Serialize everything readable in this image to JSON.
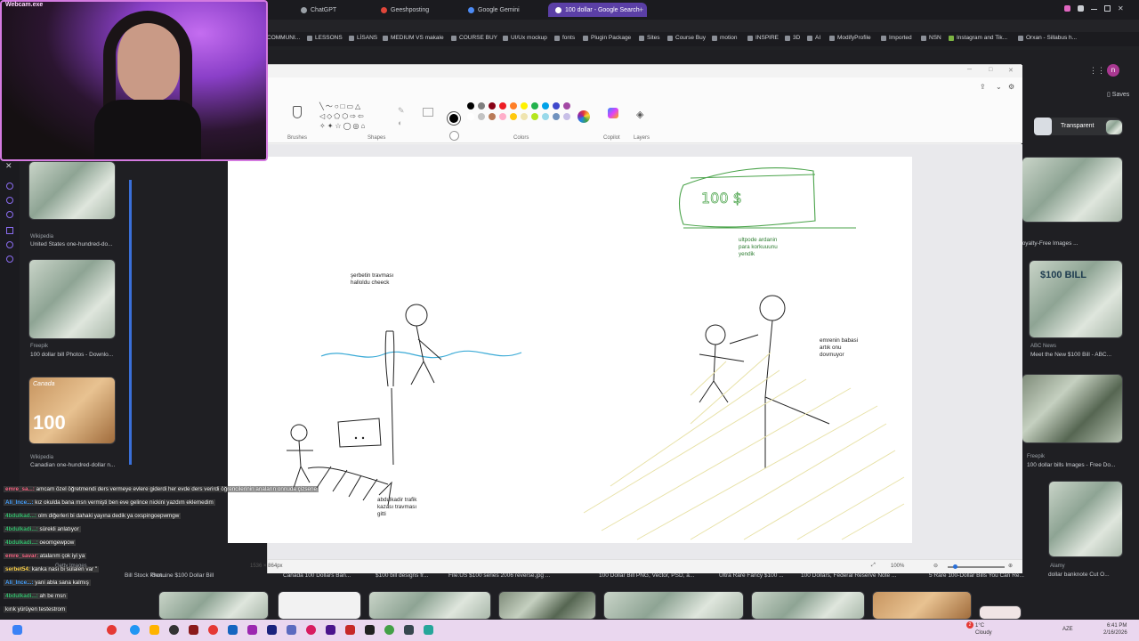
{
  "webcam": {
    "label": "Webcam.exe"
  },
  "browser": {
    "tabs": [
      {
        "label": "ChatGPT",
        "color": "#9aa0a6"
      },
      {
        "label": "Geeshposting",
        "color": "#e0463a"
      },
      {
        "label": "Google Gemini",
        "color": "#4c8bf5"
      },
      {
        "label": "100 dollar - Google Search",
        "color": "#ffffff"
      }
    ],
    "new_tab": "+",
    "bookmarks": [
      "COMMUNI...",
      "LESSONS",
      "LİSANS",
      "MEDIUM VS makale",
      "COURSE BUY",
      "UI/Ux mockup",
      "fonts",
      "Plugin Package",
      "Sites",
      "Course Buy",
      "motion",
      "INSPIRE",
      "3D",
      "AI",
      "ModifyProfile",
      "Imported",
      "NSN",
      "Instagram and Tik...",
      "Orxan - Sillabus h..."
    ],
    "profile_initial": "n",
    "saves_label": "Saves",
    "transparent_label": "Transparent"
  },
  "paint": {
    "groups": {
      "brushes": "Brushes",
      "shapes": "Shapes",
      "colors": "Colors",
      "copilot": "Copilot",
      "layers": "Layers"
    },
    "palette_row1": [
      "#000000",
      "#7f7f7f",
      "#880015",
      "#ed1c24",
      "#ff7f27",
      "#fff200",
      "#22b14c",
      "#00a2e8",
      "#3f48cc",
      "#a349a4"
    ],
    "palette_row2": [
      "#ffffff",
      "#c3c3c3",
      "#b97a57",
      "#ffaec9",
      "#ffc90e",
      "#efe4b0",
      "#b5e61d",
      "#99d9ea",
      "#7092be",
      "#c8bfe7"
    ],
    "status_size": "1536 × 864px",
    "zoom": "100%",
    "notes": {
      "serbet": "şerbetin travması\nhalloldu cheeck",
      "abdulkadir": "abdulkadir trafik\nkazası travması\ngitti",
      "ultpode": "ultpode ardanin\npara korkuuunu\nyendik",
      "emre": "emrenin babasi\nartık onu\ndovmuyor"
    },
    "sign_text": "100 $"
  },
  "results": {
    "left_items": [
      {
        "source": "Wikipedia",
        "title": "United States one-hundred-do..."
      },
      {
        "source": "Freepik",
        "title": "100 dollar bill Photos - Downlo..."
      },
      {
        "source": "Wikipedia",
        "title": "Canadian one-hundred-dollar n..."
      }
    ],
    "left_extra": "Getty Images",
    "canada_word": "Canada",
    "canada_value": "100",
    "bottom_titles": [
      "Canada 100 Dollars Ban...",
      "$100 bill designs fr...",
      "File:US $100 series 2006 reverse.jpg ...",
      "100 Dollar Bill PNG, Vector, PSD, a...",
      "Ultra Rare Fancy $100 ...",
      "100 Dollars, Federal Reserve Note ...",
      "5 Rare 100-Dollar Bills You Can Re...",
      "dollar banknote Cut O..."
    ],
    "left_bottom": [
      "Bill Stock Phot...",
      "Genuine $100 Dollar Bill"
    ],
    "right_items": [
      {
        "source": "",
        "title": "Royalty-Free Images ..."
      },
      {
        "source": "ABC News",
        "title": "Meet the New $100 Bill - ABC..."
      },
      {
        "source": "Freepik",
        "title": "100 dollar bills Images - Free Do..."
      },
      {
        "source": "Alamy",
        "title": "dollar banknote Cut O..."
      }
    ],
    "right_badge": "$100 BILL"
  },
  "chat": [
    {
      "user": "emre_sa...",
      "color": "#ff6b8b",
      "text": "amcam özel öğretmendi ders vermeye evlere giderdi her evde ders verirdi öğrencilerinin anaların onnuda çizsene"
    },
    {
      "user": "Ali_Ince...",
      "color": "#4aa3ff",
      "text": "kız okulda bana msn vermişti ben eve gelince nickini yazdım eklemedim"
    },
    {
      "user": "4bdulkad...",
      "color": "#38c172",
      "text": "olm diğerleri bi dahaki yayına dedik ya oxspingoepwmgw"
    },
    {
      "user": "4bdulkadi...",
      "color": "#38c172",
      "text": "sürekli anlatıyor"
    },
    {
      "user": "4bdulkadi...",
      "color": "#38c172",
      "text": "oeomgewpow"
    },
    {
      "user": "emre_savar",
      "color": "#ff6b8b",
      "text": "atalarım çok iyi ya"
    },
    {
      "user": "serbet54",
      "color": "#ffd34d",
      "text": "kanka nası bi sülalen var '' "
    },
    {
      "user": "Ali_Ince...",
      "color": "#4aa3ff",
      "text": "yani abla sana kalmış"
    },
    {
      "user": "4bdulkadi...",
      "color": "#38c172",
      "text": "ah be msn"
    },
    {
      "user": "",
      "color": "#ffffff",
      "text": "kırık yürüyen testestrom"
    }
  ],
  "taskbar": {
    "weather_temp": "1°C",
    "weather_desc": "Cloudy",
    "lang": "AZE",
    "time": "6:41 PM",
    "date": "2/16/2026",
    "notif_count": "2"
  }
}
